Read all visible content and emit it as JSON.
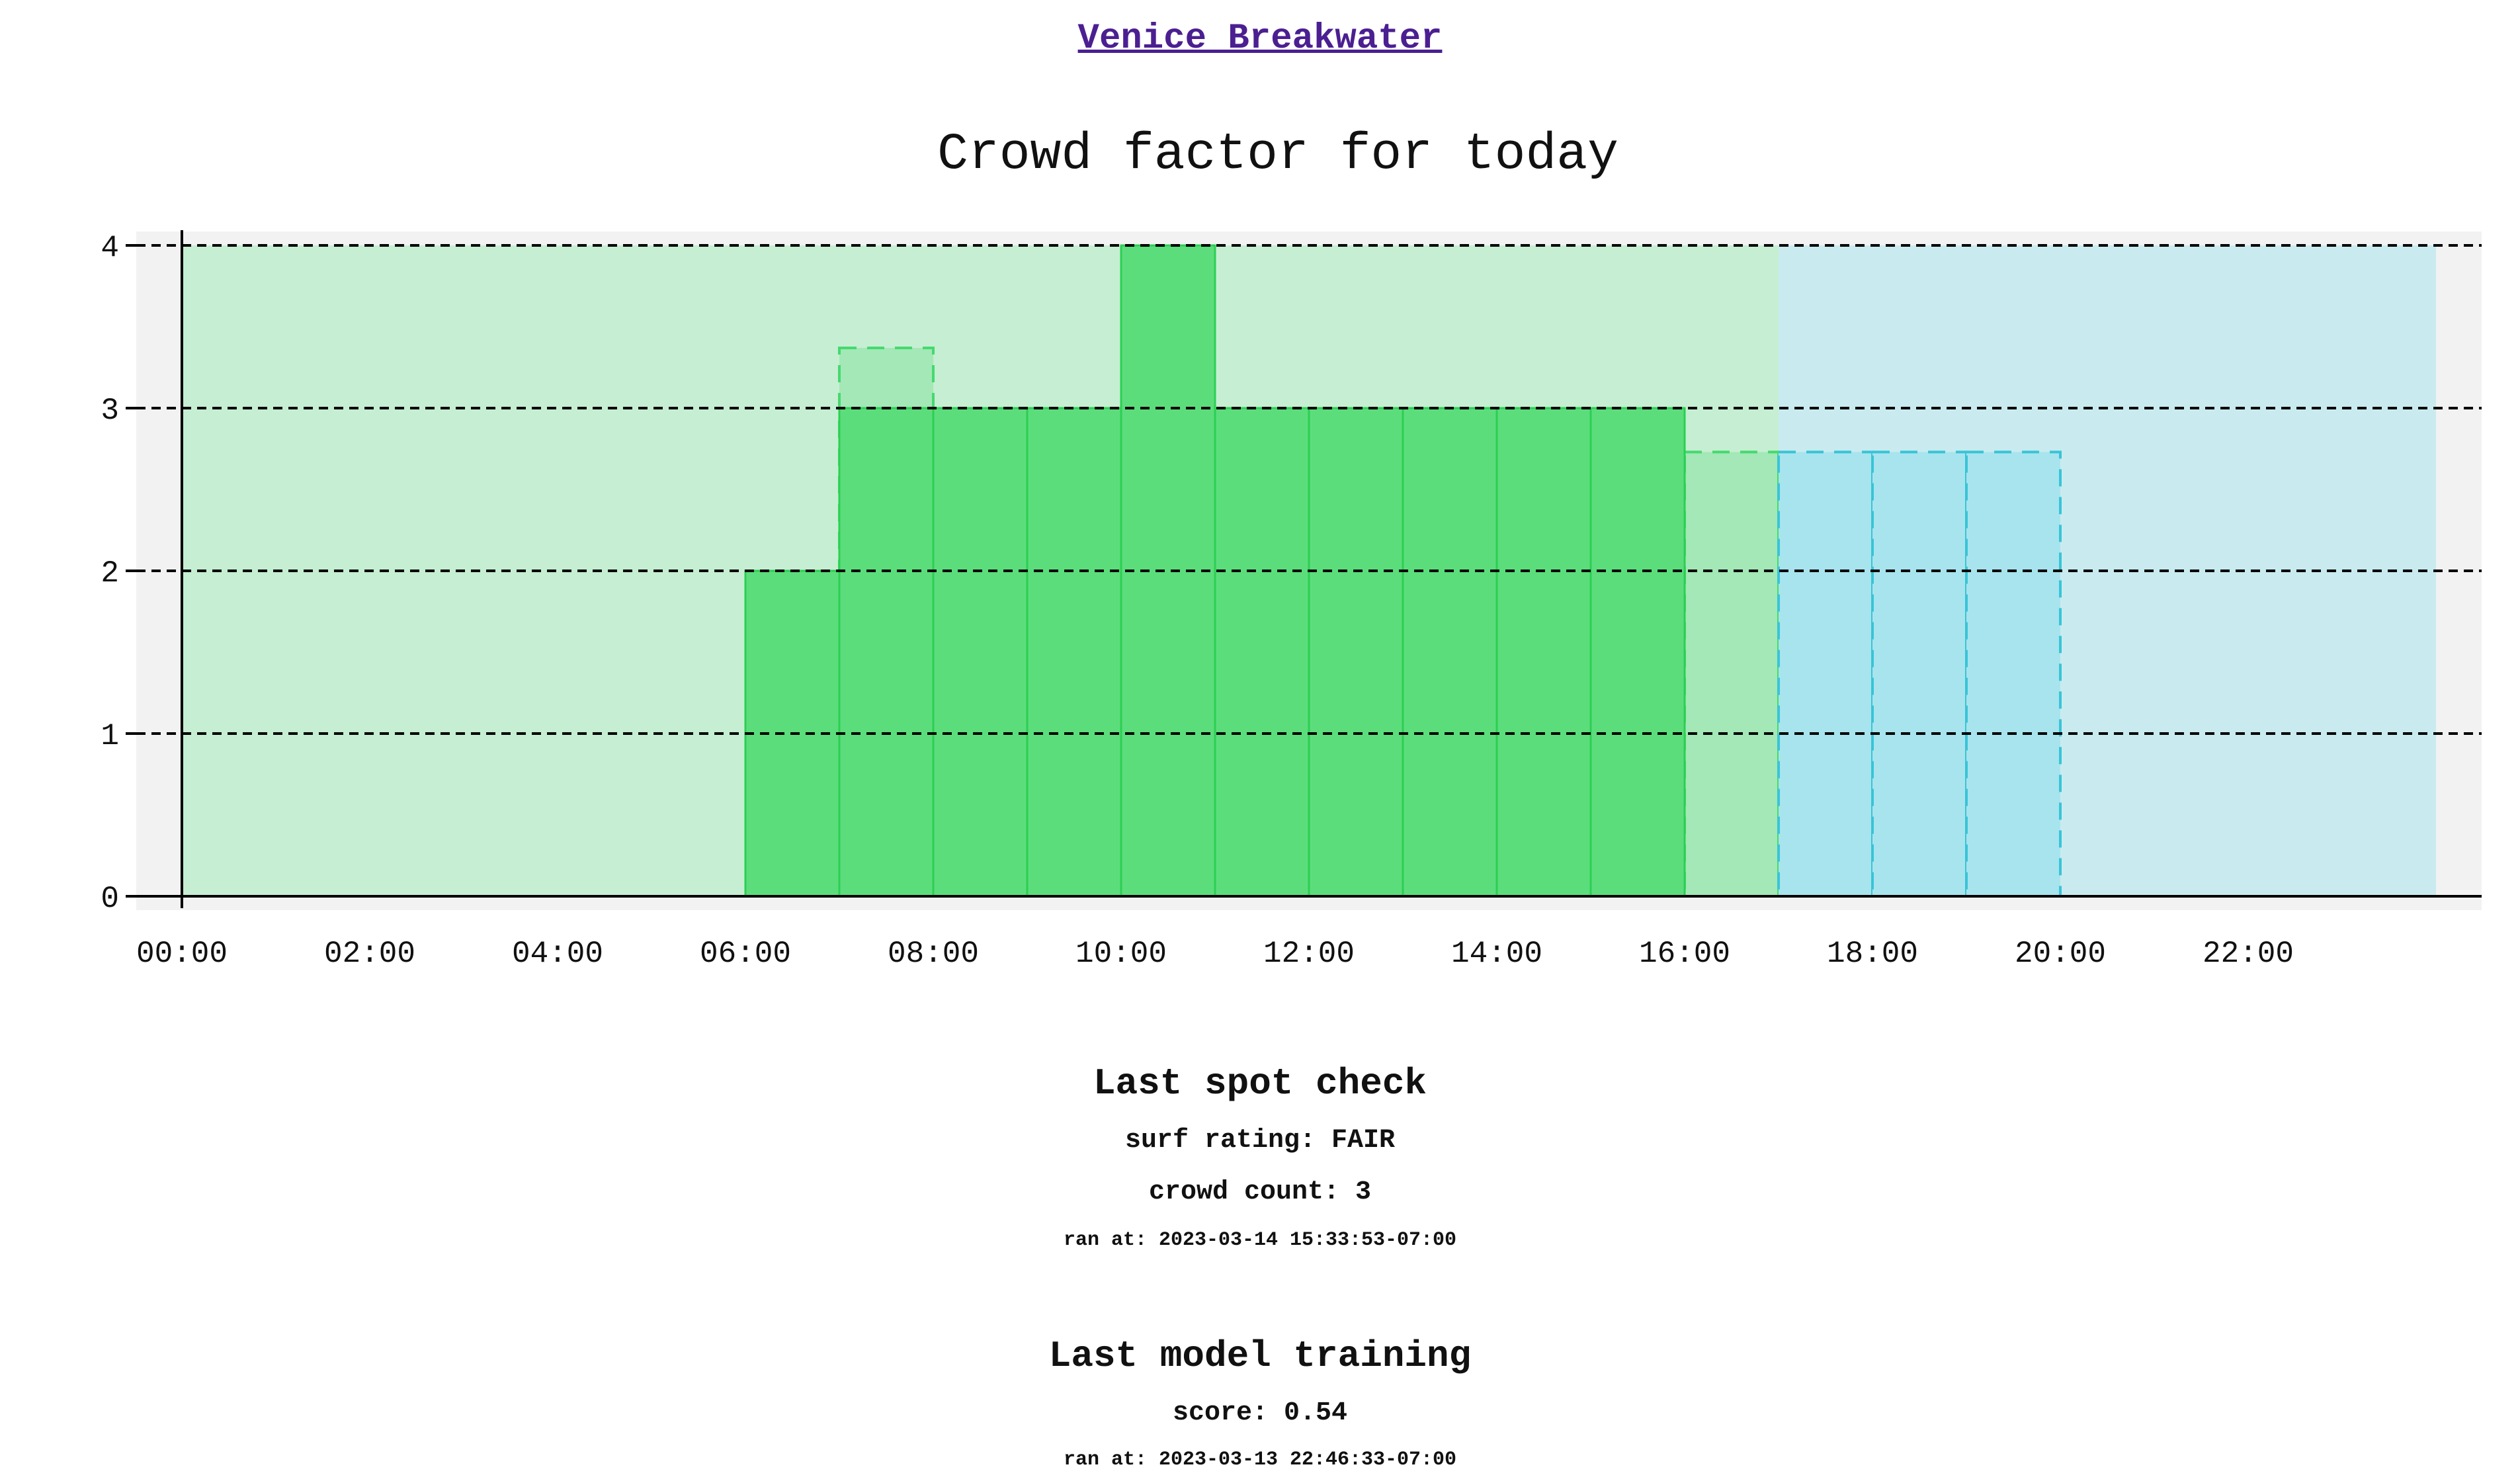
{
  "spot": {
    "name": "Venice Breakwater"
  },
  "chart_data": {
    "type": "bar",
    "title": "Crowd factor for today",
    "xlabel": "",
    "ylabel": "",
    "ylim": [
      0,
      4
    ],
    "yticks": [
      0,
      1,
      2,
      3,
      4
    ],
    "xlim_hours": [
      0,
      24
    ],
    "xtick_labels": [
      "00:00",
      "02:00",
      "04:00",
      "06:00",
      "08:00",
      "10:00",
      "12:00",
      "14:00",
      "16:00",
      "18:00",
      "20:00",
      "22:00"
    ],
    "grid": "horizontal-dashed",
    "bar_width_hours": 1,
    "background_bands": [
      {
        "start_hour": 0,
        "end_hour": 17,
        "color": "#c6eed2"
      },
      {
        "start_hour": 17,
        "end_hour": 24,
        "color": "#c9ebef"
      }
    ],
    "series": [
      {
        "style": "solid",
        "fill": "#5cdd7c",
        "stroke": "#2bcf52",
        "x": [
          "06:00",
          "07:00",
          "08:00",
          "09:00",
          "10:00",
          "11:00",
          "12:00",
          "13:00",
          "14:00",
          "15:00"
        ],
        "values": [
          2,
          3,
          3,
          3,
          4,
          3,
          3,
          3,
          3,
          3
        ]
      },
      {
        "style": "dashed",
        "x": [
          "07:00",
          "08:00",
          "09:00",
          "10:00",
          "11:00",
          "12:00",
          "13:00",
          "14:00",
          "15:00",
          "16:00",
          "17:00",
          "18:00",
          "19:00"
        ],
        "values": [
          3.37,
          2.73,
          2.73,
          2.73,
          2.73,
          2.73,
          2.73,
          2.73,
          2.73,
          2.73,
          2.73,
          2.73,
          2.73
        ],
        "colors": {
          "day": {
            "fill": "#a3e8b6",
            "stroke": "#45d96f"
          },
          "night": {
            "fill": "#a8e4ee",
            "stroke": "#39c4d6"
          }
        }
      }
    ]
  },
  "spot_check": {
    "heading": "Last spot check",
    "surf_rating": "surf rating: FAIR",
    "crowd_count": "crowd count: 3",
    "ran_at": "ran at: 2023-03-14 15:33:53-07:00"
  },
  "model_training": {
    "heading": "Last model training",
    "score": "score: 0.54",
    "ran_at": "ran at: 2023-03-13 22:46:33-07:00"
  }
}
